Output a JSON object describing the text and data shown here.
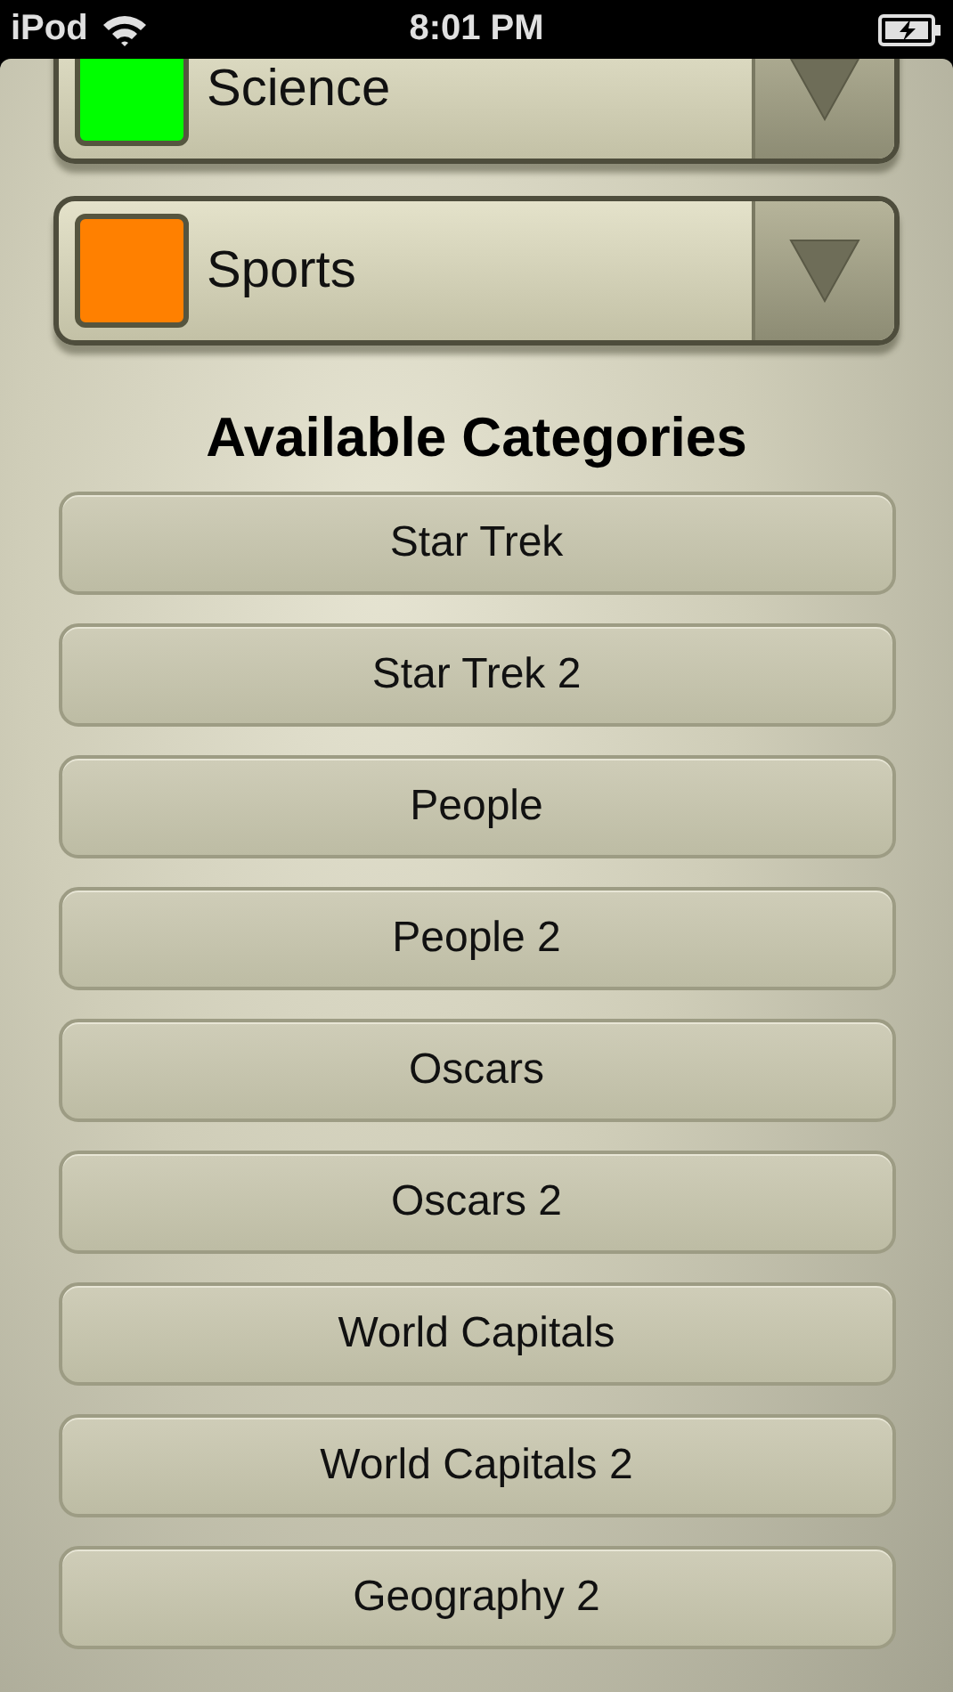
{
  "status_bar": {
    "carrier": "iPod",
    "time": "8:01 PM"
  },
  "selected_categories": [
    {
      "name": "Science",
      "color": "#00ff00"
    },
    {
      "name": "Sports",
      "color": "#ff8000"
    }
  ],
  "heading": "Available Categories",
  "available_categories": [
    "Star Trek",
    "Star Trek 2",
    "People",
    "People 2",
    "Oscars",
    "Oscars 2",
    "World Capitals",
    "World Capitals 2",
    "Geography 2"
  ]
}
